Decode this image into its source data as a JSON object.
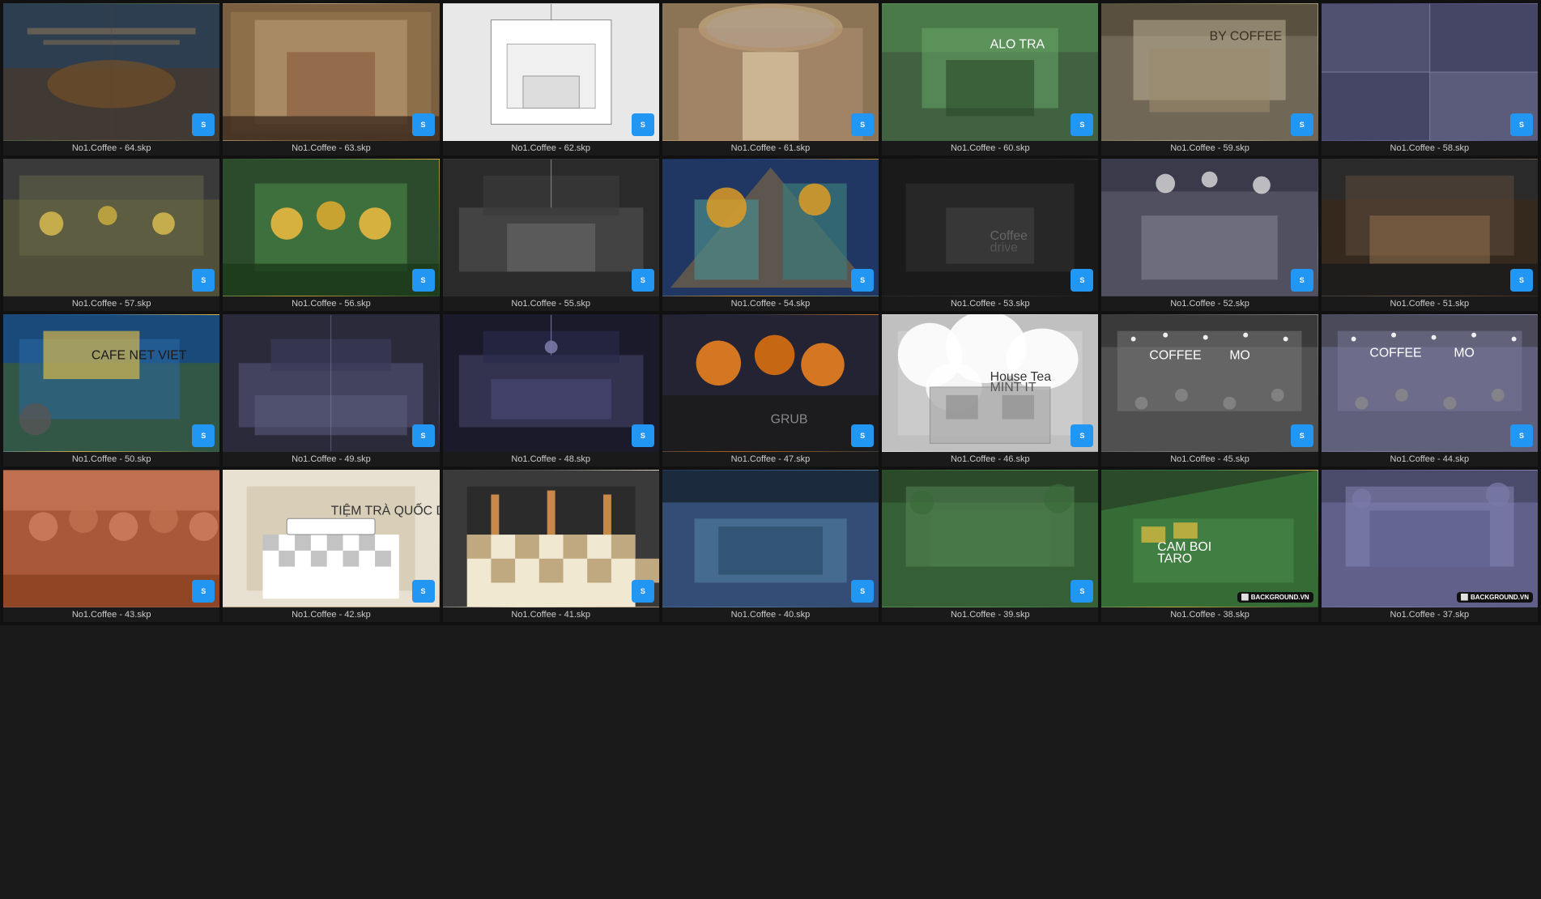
{
  "grid": {
    "items": [
      {
        "id": "64",
        "label": "No1.Coffee - 64.skp",
        "imgClass": "img-64",
        "hasBadge": true,
        "isLast": false
      },
      {
        "id": "63",
        "label": "No1.Coffee - 63.skp",
        "imgClass": "img-63",
        "hasBadge": true,
        "isLast": false
      },
      {
        "id": "62",
        "label": "No1.Coffee - 62.skp",
        "imgClass": "img-62",
        "hasBadge": true,
        "isLast": false
      },
      {
        "id": "61",
        "label": "No1.Coffee - 61.skp",
        "imgClass": "img-61",
        "hasBadge": true,
        "isLast": false
      },
      {
        "id": "60",
        "label": "No1.Coffee - 60.skp",
        "imgClass": "img-60",
        "hasBadge": true,
        "isLast": false
      },
      {
        "id": "59",
        "label": "No1.Coffee - 59.skp",
        "imgClass": "img-59",
        "hasBadge": true,
        "isLast": false
      },
      {
        "id": "58",
        "label": "No1.Coffee - 58.skp",
        "imgClass": "img-58",
        "hasBadge": true,
        "isLast": false
      },
      {
        "id": "57",
        "label": "No1.Coffee - 57.skp",
        "imgClass": "img-57",
        "hasBadge": true,
        "isLast": false
      },
      {
        "id": "56",
        "label": "No1.Coffee - 56.skp",
        "imgClass": "img-56",
        "hasBadge": true,
        "isLast": false
      },
      {
        "id": "55",
        "label": "No1.Coffee - 55.skp",
        "imgClass": "img-55",
        "hasBadge": true,
        "isLast": false
      },
      {
        "id": "54",
        "label": "No1.Coffee - 54.skp",
        "imgClass": "img-54",
        "hasBadge": true,
        "isLast": false
      },
      {
        "id": "53",
        "label": "No1.Coffee - 53.skp",
        "imgClass": "img-53",
        "hasBadge": true,
        "isLast": false
      },
      {
        "id": "52",
        "label": "No1.Coffee - 52.skp",
        "imgClass": "img-52",
        "hasBadge": true,
        "isLast": false
      },
      {
        "id": "51",
        "label": "No1.Coffee - 51.skp",
        "imgClass": "img-51",
        "hasBadge": true,
        "isLast": false
      },
      {
        "id": "50",
        "label": "No1.Coffee - 50.skp",
        "imgClass": "img-50",
        "hasBadge": true,
        "isLast": false
      },
      {
        "id": "49",
        "label": "No1.Coffee - 49.skp",
        "imgClass": "img-49",
        "hasBadge": true,
        "isLast": false
      },
      {
        "id": "48",
        "label": "No1.Coffee - 48.skp",
        "imgClass": "img-48",
        "hasBadge": true,
        "isLast": false
      },
      {
        "id": "47",
        "label": "No1.Coffee - 47.skp",
        "imgClass": "img-47",
        "hasBadge": true,
        "isLast": false
      },
      {
        "id": "46",
        "label": "No1.Coffee - 46.skp",
        "imgClass": "img-46",
        "hasBadge": true,
        "isLast": false,
        "hasHouseTea": true
      },
      {
        "id": "45",
        "label": "No1.Coffee - 45.skp",
        "imgClass": "img-45",
        "hasBadge": true,
        "isLast": false
      },
      {
        "id": "44",
        "label": "No1.Coffee - 44.skp",
        "imgClass": "img-44",
        "hasBadge": true,
        "isLast": false
      },
      {
        "id": "43",
        "label": "No1.Coffee - 43.skp",
        "imgClass": "img-43",
        "hasBadge": true,
        "isLast": false
      },
      {
        "id": "42",
        "label": "No1.Coffee - 42.skp",
        "imgClass": "img-42",
        "hasBadge": true,
        "isLast": false
      },
      {
        "id": "41",
        "label": "No1.Coffee - 41.skp",
        "imgClass": "img-41",
        "hasBadge": true,
        "isLast": false
      },
      {
        "id": "40",
        "label": "No1.Coffee - 40.skp",
        "imgClass": "img-40",
        "hasBadge": true,
        "isLast": false
      },
      {
        "id": "39",
        "label": "No1.Coffee - 39.skp",
        "imgClass": "img-39",
        "hasBadge": true,
        "isLast": false
      },
      {
        "id": "38",
        "label": "No1.Coffee - 38.skp",
        "imgClass": "img-38",
        "hasBadge": false,
        "isLast": true
      },
      {
        "id": "37",
        "label": "No1.Coffee - 37.skp",
        "imgClass": "img-37",
        "hasBadge": false,
        "isLast": true
      }
    ],
    "badge_label": "S",
    "background_label": "BACKGROUND.VN"
  }
}
